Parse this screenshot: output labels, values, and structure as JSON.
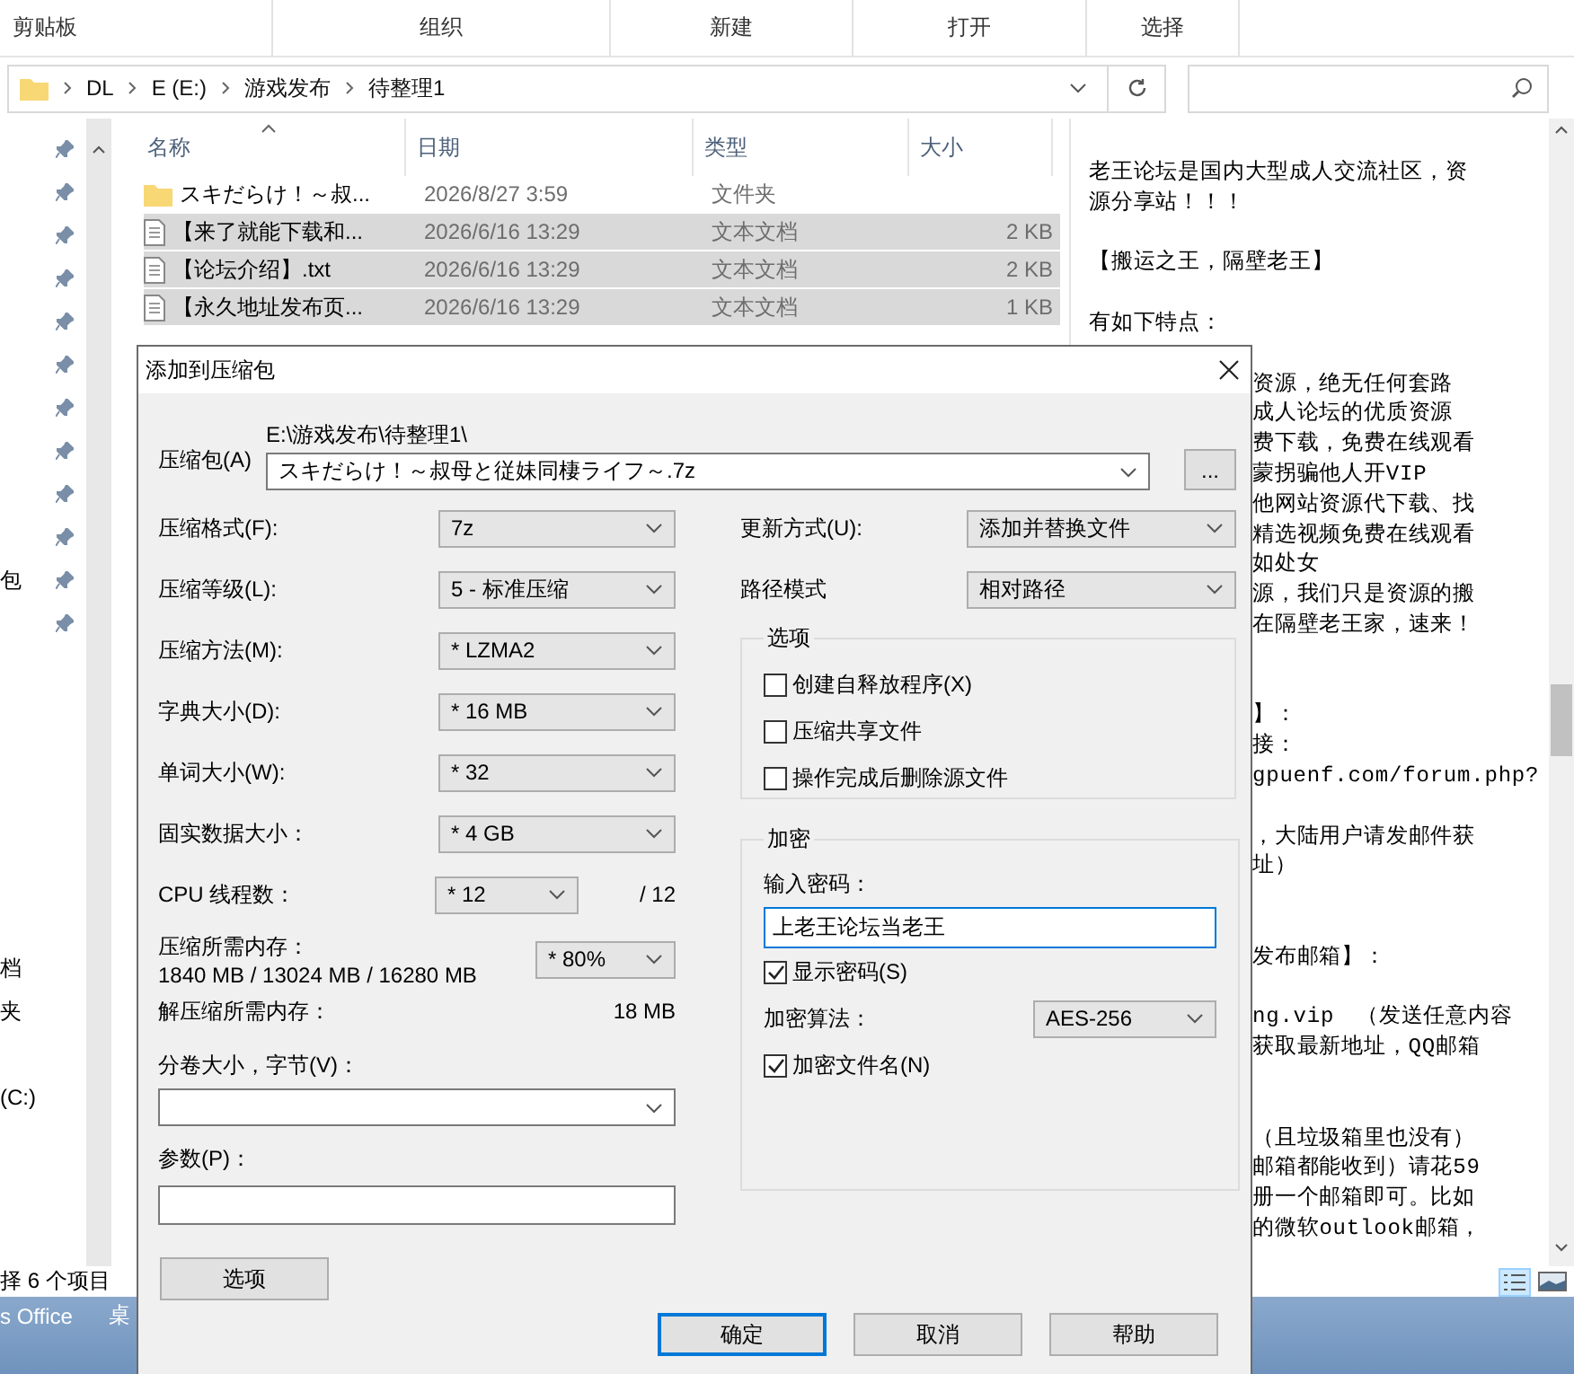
{
  "ribbon": {
    "groups": [
      "剪贴板",
      "组织",
      "新建",
      "打开",
      "选择"
    ]
  },
  "address_bar": {
    "path": [
      "DL",
      "E (E:)",
      "游戏发布",
      "待整理1"
    ]
  },
  "nav_pane": {
    "items": [
      {
        "pinned": true
      },
      {
        "pinned": true
      },
      {
        "pinned": true
      },
      {
        "pinned": true
      },
      {
        "pinned": true
      },
      {
        "pinned": true
      },
      {
        "pinned": true
      },
      {
        "pinned": true
      },
      {
        "pinned": true
      },
      {
        "pinned": true
      },
      {
        "pinned": true,
        "label": "包"
      },
      {
        "pinned": true
      },
      {
        "pinned": false
      },
      {
        "pinned": false
      },
      {
        "pinned": false
      },
      {
        "pinned": false
      },
      {
        "pinned": false
      },
      {
        "pinned": false
      },
      {
        "pinned": false
      },
      {
        "pinned": false,
        "label": "档"
      },
      {
        "pinned": false,
        "label": "夹"
      },
      {
        "pinned": false
      },
      {
        "pinned": false,
        "label": "(C:)"
      }
    ]
  },
  "file_list": {
    "columns": [
      "名称",
      "日期",
      "类型",
      "大小"
    ],
    "rows": [
      {
        "kind": "folder",
        "name": "スキだらけ！～叔...",
        "date": "2026/8/27 3:59",
        "type": "文件夹",
        "selected": false
      },
      {
        "kind": "text",
        "name": "【来了就能下载和...",
        "date": "2026/6/16 13:29",
        "type": "文本文档",
        "size": "2 KB",
        "selected": true
      },
      {
        "kind": "text",
        "name": "【论坛介绍】.txt",
        "date": "2026/6/16 13:29",
        "type": "文本文档",
        "size": "2 KB",
        "selected": true
      },
      {
        "kind": "text",
        "name": "【永久地址发布页...",
        "date": "2026/6/16 13:29",
        "type": "文本文档",
        "size": "1 KB",
        "selected": true
      }
    ]
  },
  "preview": {
    "paragraphs": [
      {
        "kind": "first",
        "covered": false,
        "lines": [
          "老王论坛是国内大型成人交流社区，资",
          "源分享站！！！"
        ]
      },
      {
        "kind": "spaced",
        "covered": false,
        "lines": [
          "【搬运之王，隔壁老王】"
        ]
      },
      {
        "kind": "spaced",
        "covered": false,
        "lines": [
          "有如下特点："
        ]
      },
      {
        "kind": "spaced",
        "covered": true,
        "lines": [
          "资源，绝无任何套路",
          "成人论坛的优质资源",
          "费下载，免费在线观看",
          "蒙拐骗他人开VIP",
          "他网站资源代下载、找",
          "精选视频免费在线观看",
          "如处女",
          "源，我们只是资源的搬",
          "在隔壁老王家，速来！"
        ]
      },
      {
        "kind": "wide",
        "covered": true,
        "lines": [
          "】：",
          "接：",
          "gpuenf.com/forum.php?"
        ]
      },
      {
        "kind": "spaced",
        "covered": true,
        "lines": [
          "，大陆用户请发邮件获",
          "址）"
        ]
      },
      {
        "kind": "wide",
        "covered": true,
        "lines": [
          "发布邮箱】："
        ]
      },
      {
        "kind": "spaced",
        "covered": true,
        "lines": [
          "ng.vip　（发送任意内容",
          "获取最新地址，QQ邮箱"
        ]
      },
      {
        "kind": "wide",
        "covered": true,
        "lines": [
          "（且垃圾箱里也没有）",
          "邮箱都能收到）请花59",
          "册一个邮箱即可。比如",
          "的微软outlook邮箱，"
        ]
      }
    ]
  },
  "status_bar": {
    "text": "择 6 个项目"
  },
  "taskbar": {
    "items": [
      "s Office",
      "桌"
    ]
  },
  "dialog": {
    "title": "添加到压缩包",
    "archive": {
      "label": "压缩包(A)",
      "folder": "E:\\游戏发布\\待整理1\\",
      "name": "スキだらけ！～叔母と従妹同棲ライフ～.7z",
      "browse": "..."
    },
    "settings": [
      {
        "kind": "combo",
        "label": "压缩格式(F):",
        "value": "7z"
      },
      {
        "kind": "combo",
        "label": "压缩等级(L):",
        "value": "5 - 标准压缩"
      },
      {
        "kind": "combo",
        "label": "压缩方法(M):",
        "value": "* LZMA2"
      },
      {
        "kind": "combo",
        "label": "字典大小(D):",
        "value": "* 16 MB"
      },
      {
        "kind": "combo",
        "label": "单词大小(W):",
        "value": "* 32"
      },
      {
        "kind": "combo",
        "label": "固实数据大小：",
        "value": "* 4 GB"
      },
      {
        "kind": "short",
        "label": "CPU 线程数：",
        "value": "* 12",
        "suffix": "/ 12"
      }
    ],
    "memory": {
      "label": "压缩所需内存：",
      "detail": "1840 MB / 13024 MB / 16280 MB",
      "value": "* 80%"
    },
    "decompress": {
      "label": "解压缩所需内存：",
      "value": "18 MB"
    },
    "volume": {
      "label": "分卷大小，字节(V)："
    },
    "params": {
      "label": "参数(P)："
    },
    "options_button": "选项",
    "update": {
      "label": "更新方式(U):",
      "value": "添加并替换文件"
    },
    "path_mode": {
      "label": "路径模式",
      "value": "相对路径"
    },
    "options_group": {
      "title": "选项",
      "checkboxes": [
        {
          "label": "创建自释放程序(X)",
          "checked": false
        },
        {
          "label": "压缩共享文件",
          "checked": false
        },
        {
          "label": "操作完成后删除源文件",
          "checked": false
        }
      ]
    },
    "encryption": {
      "title": "加密",
      "password_label": "输入密码：",
      "password": "上老王论坛当老王",
      "show_password": {
        "label": "显示密码(S)",
        "checked": true
      },
      "method_label": "加密算法：",
      "method": "AES-256",
      "encrypt_names": {
        "label": "加密文件名(N)",
        "checked": true
      }
    },
    "buttons": [
      {
        "label": "确定",
        "default": true
      },
      {
        "label": "取消",
        "default": false
      },
      {
        "label": "帮助",
        "default": false
      }
    ]
  }
}
